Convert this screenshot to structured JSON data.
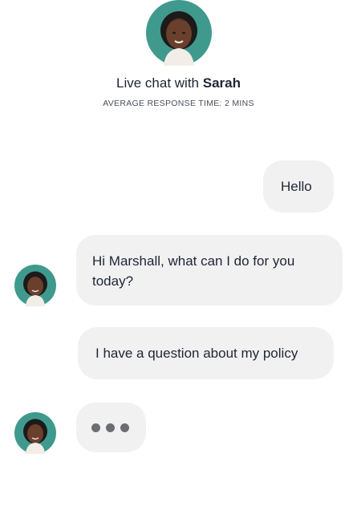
{
  "header": {
    "title_prefix": "Live chat with ",
    "agent_name": "Sarah",
    "subtitle": "AVERAGE RESPONSE TIME: 2 MINS"
  },
  "messages": [
    {
      "sender": "user",
      "text": "Hello"
    },
    {
      "sender": "agent",
      "text": "Hi Marshall, what can I do for you today?"
    },
    {
      "sender": "user",
      "text": "I have a question about my policy"
    },
    {
      "sender": "agent",
      "typing": true
    }
  ],
  "colors": {
    "avatar_bg": "#3f9a8d",
    "bubble_bg": "#f1f1f2",
    "text": "#1f2533",
    "typing_dot": "#6b6d72"
  },
  "icons": {
    "agent_avatar": "person-avatar-icon",
    "typing": "typing-dots-icon"
  }
}
